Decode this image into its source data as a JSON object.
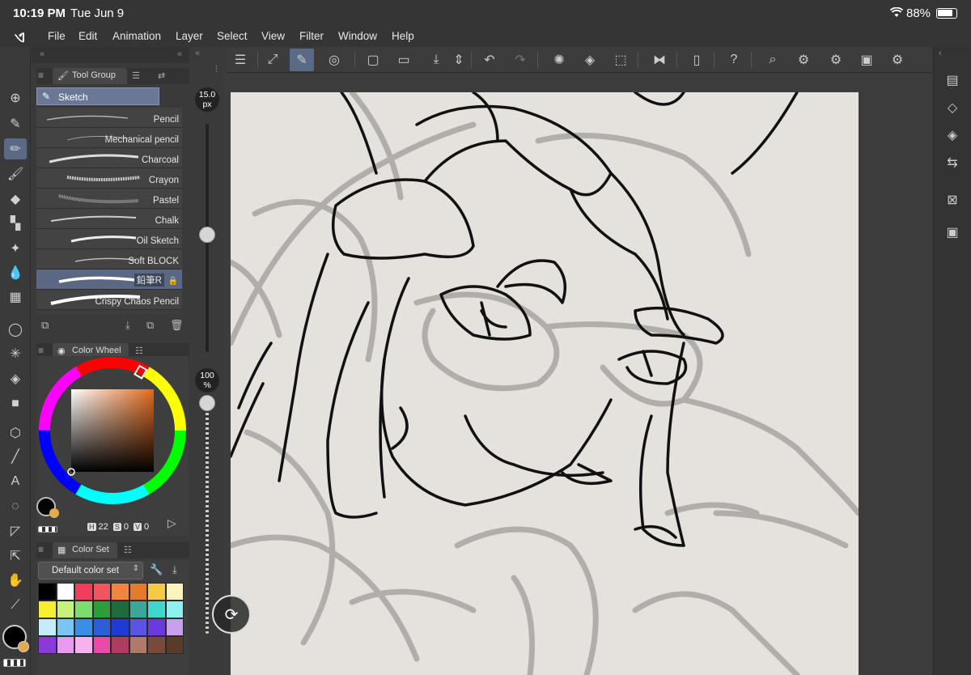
{
  "status": {
    "time": "10:19 PM",
    "date": "Tue Jun 9",
    "battery": "88%"
  },
  "menu": [
    "File",
    "Edit",
    "Animation",
    "Layer",
    "Select",
    "View",
    "Filter",
    "Window",
    "Help"
  ],
  "tool_group": {
    "tab_label": "Tool Group",
    "sub_tool": "Sketch"
  },
  "brushes": [
    {
      "name": "Pencil"
    },
    {
      "name": "Mechanical pencil"
    },
    {
      "name": "Charcoal"
    },
    {
      "name": "Crayon"
    },
    {
      "name": "Pastel"
    },
    {
      "name": "Chalk"
    },
    {
      "name": "Oil Sketch"
    },
    {
      "name": "Soft BLOCK"
    },
    {
      "name": "鉛筆R",
      "selected": true
    },
    {
      "name": "Crispy Chaos Pencil"
    }
  ],
  "brush_size": {
    "value": "15.0",
    "unit": "px"
  },
  "opacity": {
    "value": "100",
    "unit": "%"
  },
  "color_wheel": {
    "tab_label": "Color Wheel",
    "h": "22",
    "s": "0",
    "v": "0",
    "main_color": "#000000",
    "sub_color": "#e8a94a"
  },
  "color_set": {
    "tab_label": "Color Set",
    "set_name": "Default color set",
    "swatches": [
      "#000000",
      "#ffffff",
      "#ef3f5c",
      "#f0565f",
      "#f08443",
      "#e27b2c",
      "#f6c948",
      "#fdf3c0",
      "#f6f032",
      "#c7f07d",
      "#7ddc6d",
      "#2f9e3a",
      "#1e6b3e",
      "#3aa79a",
      "#3fd6cc",
      "#8ff0ef",
      "#c5ecfa",
      "#79c6f5",
      "#3a8ee8",
      "#2b5ed8",
      "#1f3bd4",
      "#5a55e6",
      "#6a3ae0",
      "#c8a0f0",
      "#8a3ad8",
      "#e89af0",
      "#f7b0f0",
      "#e84aa8",
      "#b03a60",
      "#b07a6a",
      "#7a4a3a",
      "#5a3a2a"
    ]
  }
}
